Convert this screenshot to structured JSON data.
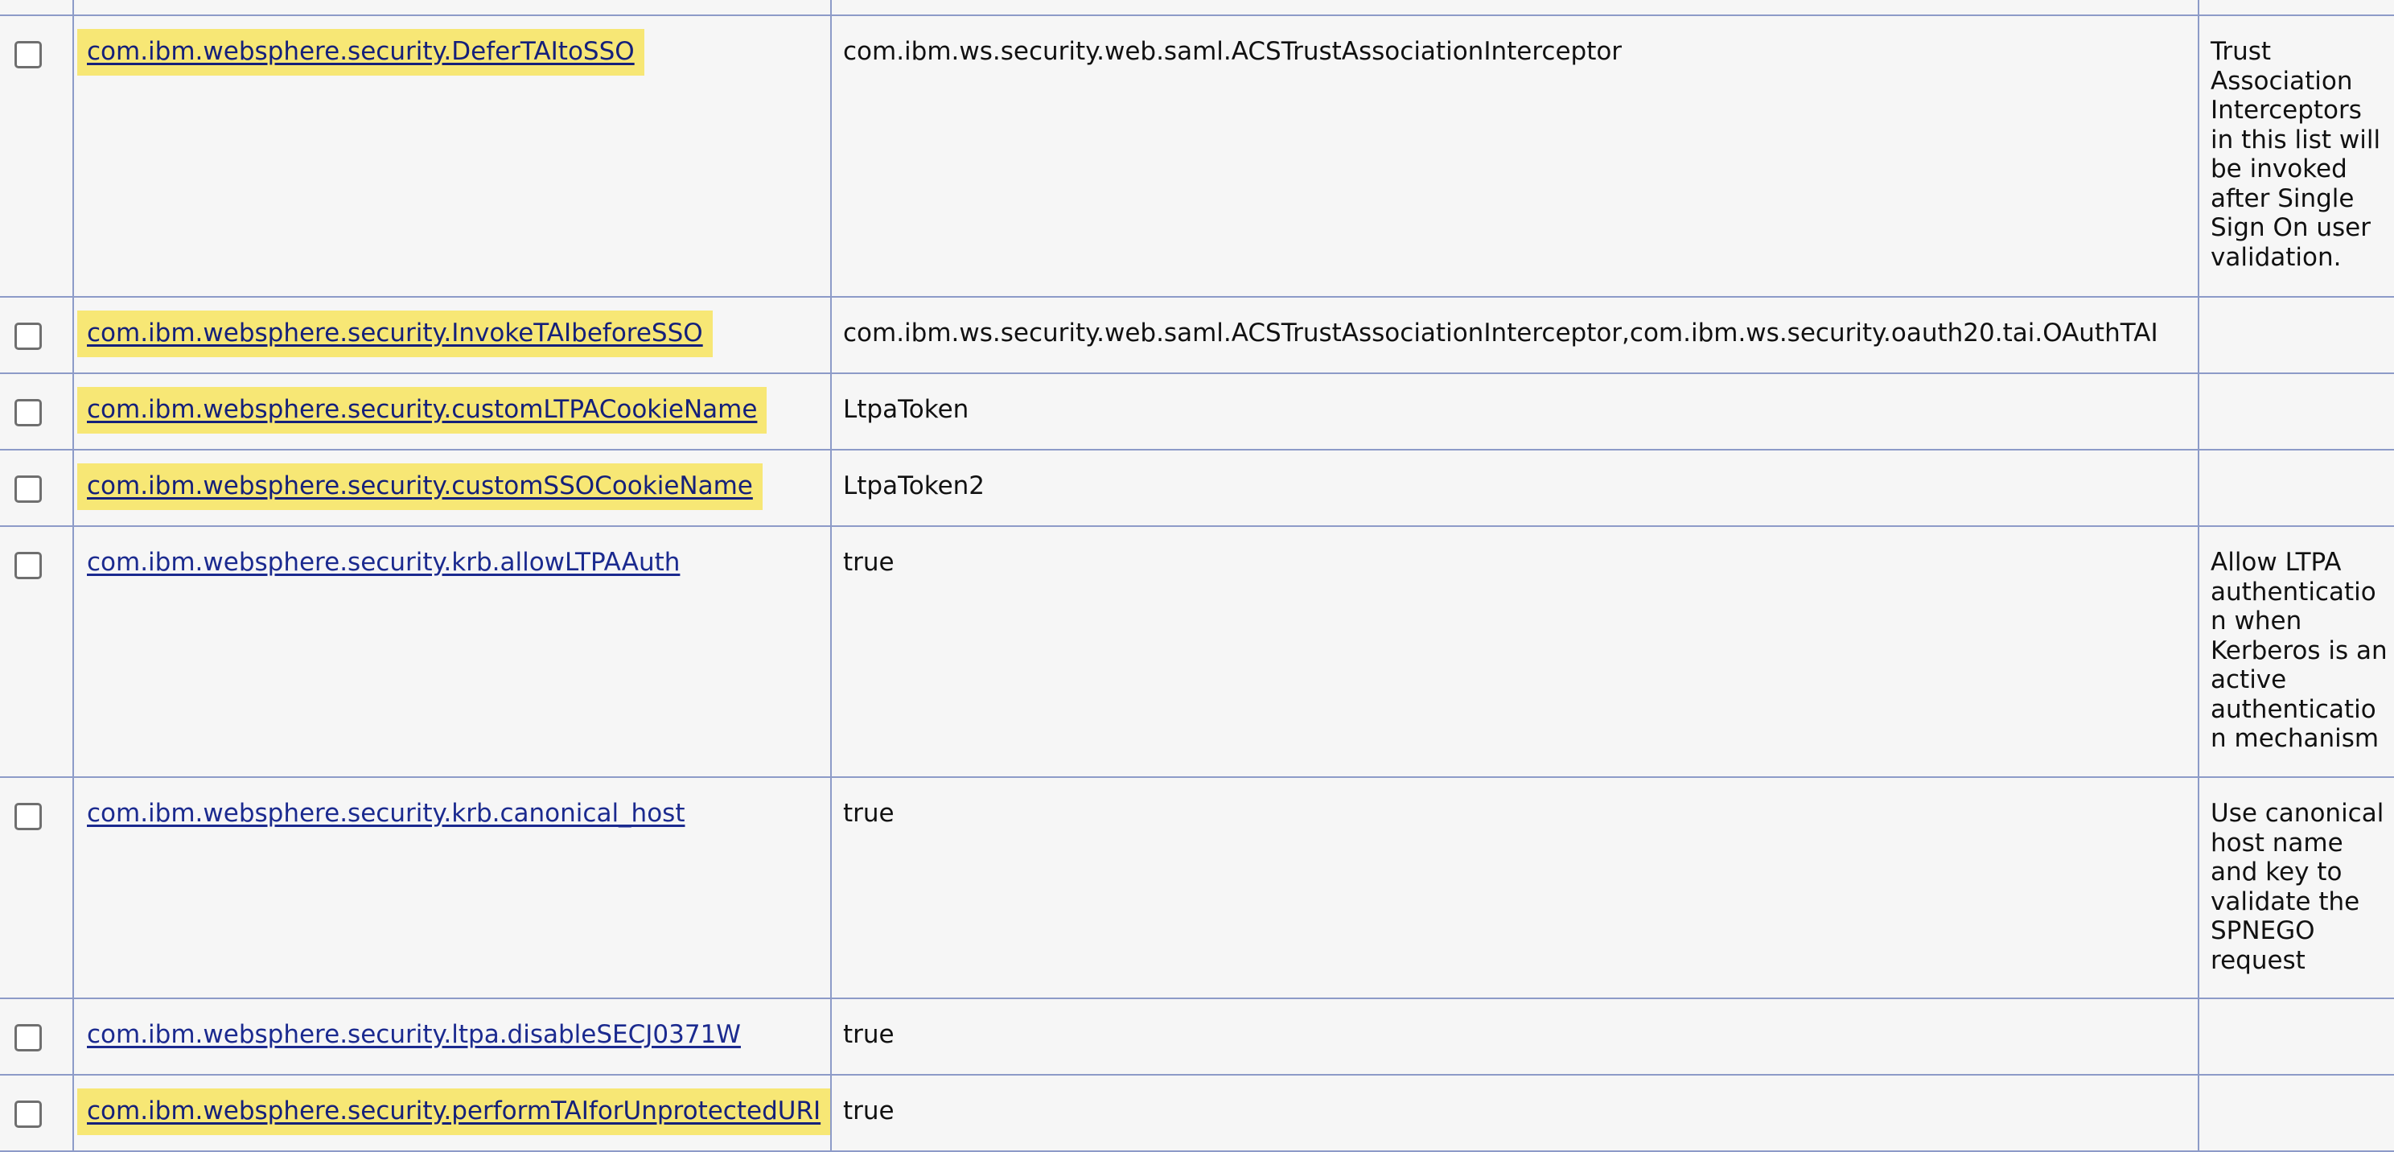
{
  "properties": [
    {
      "name": "com.ibm.websphere.security.DeferTAItoSSO",
      "value": "com.ibm.ws.security.web.saml.ACSTrustAssociationInterceptor",
      "description": "Trust Association Interceptors in this list will be invoked after Single Sign On user validation.",
      "highlighted": true
    },
    {
      "name": "com.ibm.websphere.security.InvokeTAIbeforeSSO",
      "value": "com.ibm.ws.security.web.saml.ACSTrustAssociationInterceptor,com.ibm.ws.security.oauth20.tai.OAuthTAI",
      "description": "",
      "highlighted": true
    },
    {
      "name": "com.ibm.websphere.security.customLTPACookieName",
      "value": "LtpaToken",
      "description": "",
      "highlighted": true
    },
    {
      "name": "com.ibm.websphere.security.customSSOCookieName",
      "value": "LtpaToken2",
      "description": "",
      "highlighted": true
    },
    {
      "name": "com.ibm.websphere.security.krb.allowLTPAAuth",
      "value": "true",
      "description": "Allow LTPA authentication when Kerberos is an active authentication mechanism",
      "highlighted": false
    },
    {
      "name": "com.ibm.websphere.security.krb.canonical_host",
      "value": "true",
      "description": "Use canonical host name and key to validate the SPNEGO request",
      "highlighted": false
    },
    {
      "name": "com.ibm.websphere.security.ltpa.disableSECJ0371W",
      "value": "true",
      "description": "",
      "highlighted": false
    },
    {
      "name": "com.ibm.websphere.security.performTAIforUnprotectedURI",
      "value": "true",
      "description": "",
      "highlighted": true
    }
  ],
  "colors": {
    "highlight": "#f7e775",
    "link": "#1b2a8f",
    "border": "#8d9bc8",
    "background": "#f6f6f6"
  }
}
